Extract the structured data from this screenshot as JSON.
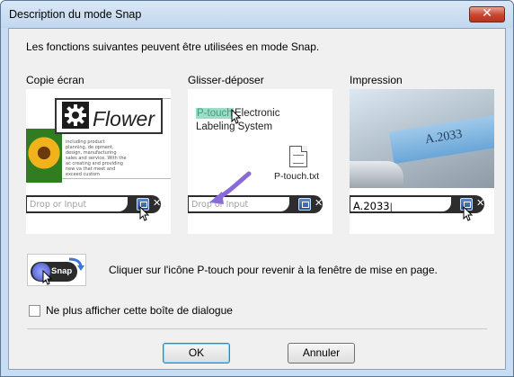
{
  "window": {
    "title": "Description du mode Snap",
    "close_glyph": "✕"
  },
  "intro": "Les fonctions suivantes peuvent être utilisées en mode Snap.",
  "panels": [
    {
      "label": "Copie écran",
      "doc_word": "Flower",
      "doc_text": "including product planning, de opment, design, manufacturing sales and service. With the ac creating and providing new va that meet and exceed custom",
      "field_placeholder": "Drop or Input"
    },
    {
      "label": "Glisser-déposer",
      "highlight_text": "P-touch",
      "line1_rest": "Electronic",
      "line2": "Labeling System",
      "file_name": "P-touch.txt",
      "field_placeholder": "Drop or Input"
    },
    {
      "label": "Impression",
      "tape_text": "A.2033",
      "field_value": "A.2033"
    }
  ],
  "snap": {
    "icon_label": "Snap",
    "text": "Cliquer sur l'icône P-touch pour revenir à la fenêtre de mise en page."
  },
  "checkbox": {
    "label": "Ne plus afficher cette boîte de dialogue",
    "checked": false
  },
  "buttons": {
    "ok": "OK",
    "cancel": "Annuler"
  },
  "colors": {
    "titlebar": "#c9ddf2",
    "close": "#c8452e",
    "highlight": "#9ddcc9"
  }
}
